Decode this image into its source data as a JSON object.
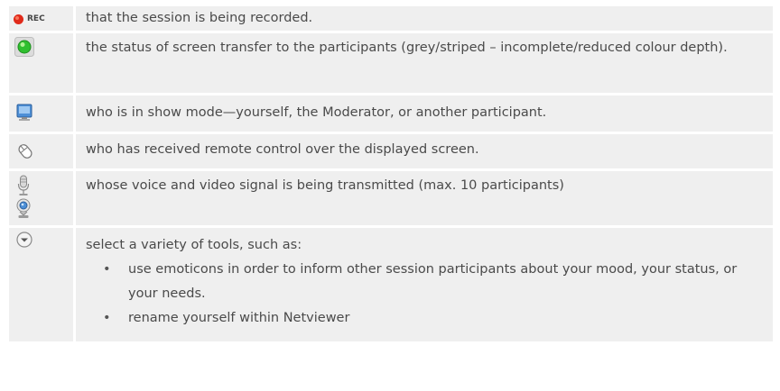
{
  "rows": [
    {
      "icon": "rec-icon",
      "rec_label": "REC",
      "text": "that the session is being recorded."
    },
    {
      "icon": "green-status-light-icon",
      "text": "the status of screen transfer to the participants (grey/striped – incomplete/reduced colour depth)."
    },
    {
      "icon": "monitor-icon",
      "text": "who is in show mode—yourself, the Moderator, or another participant."
    },
    {
      "icon": "mouse-icon",
      "text": "who has received remote control over the displayed screen."
    },
    {
      "icon": "microphone-webcam-icon",
      "text": "whose voice and video signal is being transmitted (max. 10 participants)"
    },
    {
      "icon": "dropdown-circle-icon",
      "text": "select a variety of tools, such as:",
      "bullets": [
        "use emoticons in order to inform other session participants about your mood, your status, or your needs.",
        "rename yourself within Netviewer"
      ]
    }
  ],
  "colors": {
    "cell_background": "#efefef",
    "text": "#4a4a4a",
    "rec_red": "#e02a1a",
    "status_green": "#2fbf2f"
  }
}
